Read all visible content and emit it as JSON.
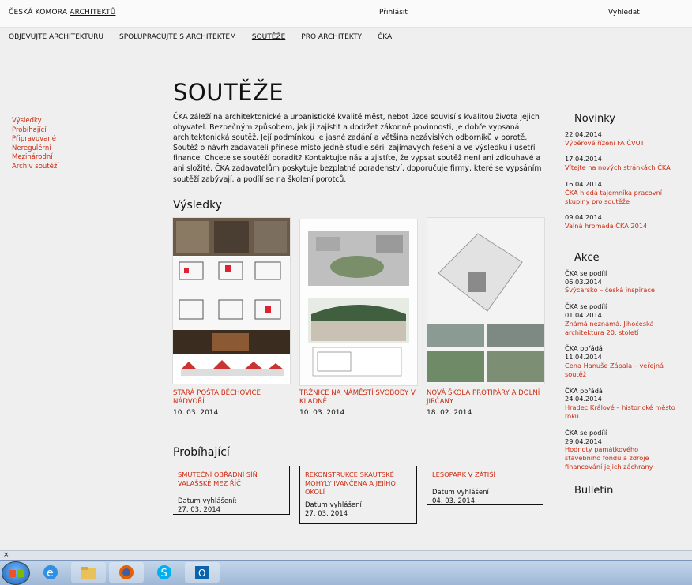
{
  "header": {
    "logo_part1": "ČESKÁ KOMORA",
    "logo_part2": "ARCHITEKTŮ",
    "center_link": "Přihlásit",
    "search_label": "Vyhledat"
  },
  "main_nav": [
    {
      "label": "OBJEVUJTE ARCHITEKTURU"
    },
    {
      "label": "SPOLUPRACUJTE S ARCHITEKTEM"
    },
    {
      "label": "SOUTĚŽE"
    },
    {
      "label": "PRO ARCHITEKTY"
    },
    {
      "label": "ČKA"
    }
  ],
  "left_nav": [
    {
      "label": "Výsledky"
    },
    {
      "label": "Probíhající"
    },
    {
      "label": "Připravované"
    },
    {
      "label": "Neregulérní"
    },
    {
      "label": "Mezinárodní"
    },
    {
      "label": "Archiv soutěží"
    }
  ],
  "page_title": "SOUTĚŽE",
  "intro_text": "ČKA záleží na architektonické a urbanistické kvalitě měst, neboť úzce souvisí s kvalitou života jejich obyvatel. Bezpečným způsobem, jak ji zajistit a dodržet zákonné povinnosti, je dobře vypsaná architektonická soutěž. Její podmínkou je jasné zadání a většina nezávislých odborníků v porotě. Soutěž o návrh zadavateli přinese místo jedné studie sérii zajímavých řešení a ve výsledku i ušetří finance. Chcete se soutěží poradit? Kontaktujte nás a zjistíte, že vypsat soutěž není ani zdlouhavé a ani složité. ČKA zadavatelům poskytuje bezplatné poradenství, doporučuje firmy, které se vypsáním soutěží zabývají, a podílí se na školení porotců.",
  "results": {
    "heading": "Výsledky",
    "items": [
      {
        "title": "STARÁ POŠTA BĚCHOVICE NÁDVOŘÍ",
        "date": "10. 03. 2014"
      },
      {
        "title": "TRŽNICE NA NÁMĚSTÍ SVOBODY V KLADNĚ",
        "date": "10. 03. 2014"
      },
      {
        "title": "NOVÁ ŠKOLA PROTIPÁRY A DOLNÍ JIRČANY",
        "date": "18. 02. 2014"
      }
    ]
  },
  "ongoing": {
    "heading": "Probíhající",
    "items": [
      {
        "title": "SMUTEČNÍ OBŘADNÍ SÍŇ VALAŠSKÉ MEZ ŘÍČ",
        "label": "Datum vyhlášení:",
        "date": "27. 03. 2014"
      },
      {
        "title": "REKONSTRUKCE SKAUTSKÉ MOHYLY IVANČENA A JEJÍHO OKOLÍ",
        "label": "Datum vyhlášení",
        "date": "27. 03. 2014"
      },
      {
        "title": "LESOPARK V ZÁTIŠÍ",
        "label": "Datum vyhlášení",
        "date": "04. 03. 2014"
      }
    ]
  },
  "sidebar": {
    "news_heading": "Novinky",
    "news": [
      {
        "date": "22.04.2014",
        "text": "Výběrové řízení FA ČVUT"
      },
      {
        "date": "17.04.2014",
        "text": "Vítejte na nových stránkách ČKA"
      },
      {
        "date": "16.04.2014",
        "text": "ČKA hledá tajemníka pracovní skupiny pro soutěže"
      },
      {
        "date": "09.04.2014",
        "text": "Valná hromada ČKA 2014"
      }
    ],
    "events_heading": "Akce",
    "events": [
      {
        "type": "ČKA se podílí",
        "date": "06.03.2014",
        "text": "Švýcarsko – česká inspirace"
      },
      {
        "type": "ČKA se podílí",
        "date": "01.04.2014",
        "text": "Známá neznámá. Jihočeská architektura 20. století"
      },
      {
        "type": "ČKA pořádá",
        "date": "11.04.2014",
        "text": "Cena Hanuše Zápala – veřejná soutěž"
      },
      {
        "type": "ČKA pořádá",
        "date": "24.04.2014",
        "text": "Hradec Králové – historické město roku"
      },
      {
        "type": "ČKA se podílí",
        "date": "29.04.2014",
        "text": "Hodnoty památkového stavebního fondu a zdroje financování jejich záchrany"
      }
    ],
    "bulletin_heading": "Bulletin"
  },
  "statusbar": {
    "text": "×"
  },
  "taskbar": {
    "apps": [
      "windows-start-icon",
      "internet-explorer-icon",
      "file-explorer-icon",
      "firefox-icon",
      "skype-icon",
      "outlook-icon"
    ]
  },
  "colors": {
    "accent": "#cc2a10",
    "background": "#efefef",
    "text": "#111111"
  }
}
